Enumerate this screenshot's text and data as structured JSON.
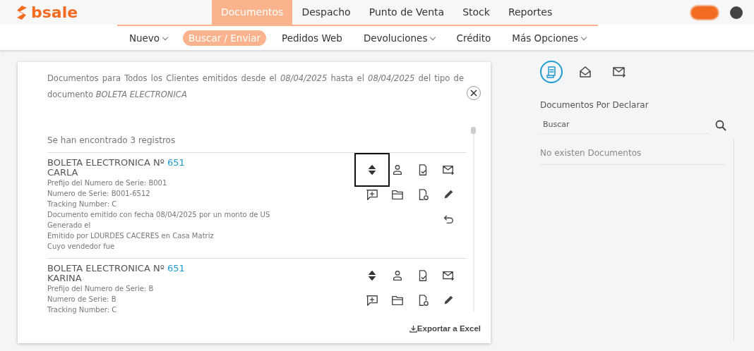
{
  "brand": {
    "name": "bsale"
  },
  "main_nav": [
    {
      "label": "Documentos",
      "selected": true
    },
    {
      "label": "Despacho",
      "selected": false
    },
    {
      "label": "Punto de Venta",
      "selected": false
    },
    {
      "label": "Stock",
      "selected": false
    },
    {
      "label": "Reportes",
      "selected": false
    }
  ],
  "sub_nav": [
    {
      "label": "Nuevo",
      "selected": false,
      "dropdown": true
    },
    {
      "label": "Buscar / Enviar",
      "selected": true,
      "dropdown": false
    },
    {
      "label": "Pedidos Web",
      "selected": false,
      "dropdown": false
    },
    {
      "label": "Devoluciones",
      "selected": false,
      "dropdown": true
    },
    {
      "label": "Crédito",
      "selected": false,
      "dropdown": false
    },
    {
      "label": "Más Opciones",
      "selected": false,
      "dropdown": true
    }
  ],
  "filter": {
    "description": "Documentos para Todos los Clientes emitidos desde el *08/04/2025* hasta el *08/04/2025* del tipo de documento *BOLETA ELECTRONICA*"
  },
  "result_count": "Se han encontrado 3 registros",
  "records": [
    {
      "title": "BOLETA ELECTRONICA Nº ",
      "number": "651",
      "client": "CARLA",
      "lines": [
        "Prefijo del Numero de Serie: B001",
        "Numero de Serie: B001-6512",
        "Tracking Number: C",
        "Documento emitido con fecha 08/04/2025 por un monto de US",
        "Generado el",
        "Emitido por LOURDES CACERES en Casa Matriz",
        "Cuyo vendedor fue"
      ],
      "actions": [
        {
          "kind": "swap",
          "focused": true
        },
        {
          "kind": "person",
          "focused": false
        },
        {
          "kind": "doc-check",
          "focused": false
        },
        {
          "kind": "mail-send",
          "focused": false
        },
        {
          "kind": "comment-add",
          "focused": false
        },
        {
          "kind": "folder",
          "focused": false
        },
        {
          "kind": "doc-link",
          "focused": false
        },
        {
          "kind": "pencil",
          "focused": false
        },
        {
          "kind": "undo",
          "focused": false
        }
      ]
    },
    {
      "title": "BOLETA ELECTRONICA Nº ",
      "number": "651",
      "client": "KARINA",
      "lines": [
        "Prefijo del Numero de Serie: B",
        "Numero de Serie: B",
        "Tracking Number: C"
      ],
      "actions": [
        {
          "kind": "swap",
          "focused": false
        },
        {
          "kind": "person",
          "focused": false
        },
        {
          "kind": "doc-check",
          "focused": false
        },
        {
          "kind": "mail-send",
          "focused": false
        },
        {
          "kind": "comment-add",
          "focused": false
        },
        {
          "kind": "folder",
          "focused": false
        },
        {
          "kind": "doc-link",
          "focused": false
        },
        {
          "kind": "pencil",
          "focused": false
        }
      ]
    }
  ],
  "export_link": "Exportar a Excel",
  "side_tabs": [
    {
      "kind": "receipt",
      "selected": true
    },
    {
      "kind": "mail-open",
      "selected": false
    },
    {
      "kind": "mail-send",
      "selected": false
    }
  ],
  "side_panel": {
    "title": "Documentos Por Declarar",
    "search": {
      "placeholder": "Buscar"
    },
    "empty_message": "No existen Documentos"
  }
}
